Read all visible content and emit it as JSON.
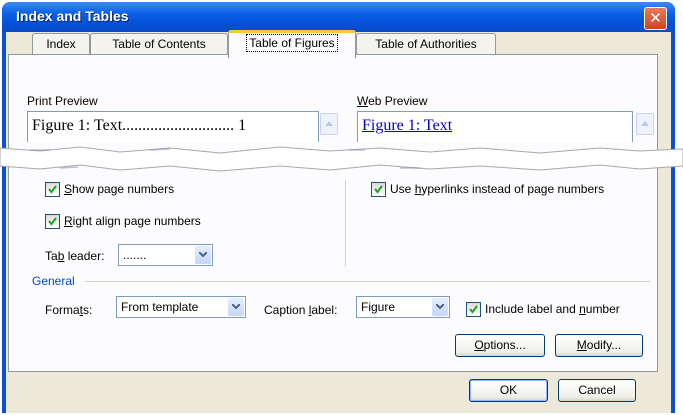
{
  "dialog": {
    "title": "Index and Tables"
  },
  "tabs": [
    "Index",
    "Table of Contents",
    "Table of Figures",
    "Table of Authorities"
  ],
  "print_preview": {
    "label": "Print Preview",
    "line1": "Figure 1: Text............................ 1"
  },
  "web_preview": {
    "label": "Web Preview",
    "line1": "Figure 1: Text"
  },
  "options": {
    "show_page_numbers": {
      "label": "Show page numbers",
      "checked": true
    },
    "right_align": {
      "label": "Right align page numbers",
      "checked": true
    },
    "use_hyperlinks": {
      "label": "Use hyperlinks instead of page numbers",
      "checked": true
    },
    "tab_leader_label": "Tab leader:",
    "tab_leader_value": "......."
  },
  "general": {
    "label": "General",
    "formats_label": "Formats:",
    "formats_value": "From template",
    "caption_label": "Caption label:",
    "caption_value": "Figure",
    "include_label": {
      "label": "Include label and number",
      "checked": true
    }
  },
  "buttons": {
    "options": "Options...",
    "modify": "Modify...",
    "ok": "OK",
    "cancel": "Cancel"
  },
  "colors": {
    "title_bar": "#0a5ee8",
    "face": "#ece9d8",
    "hyperlink": "#0000cc",
    "tab_highlight": "#ffc83c"
  }
}
